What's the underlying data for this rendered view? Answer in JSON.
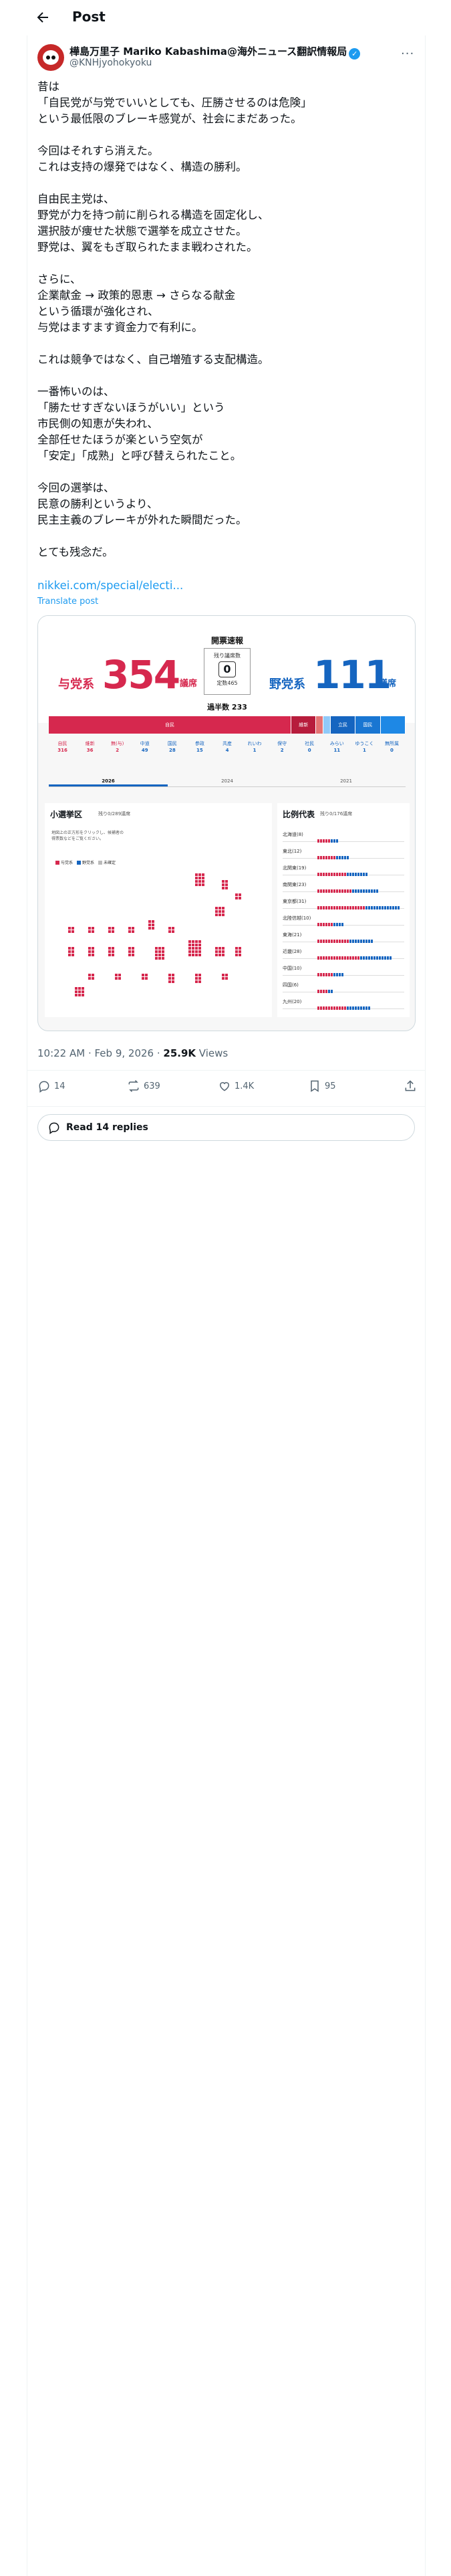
{
  "header": {
    "title": "Post"
  },
  "author": {
    "name": "樺島万里子 Mariko Kabashima@海外ニュース翻訳情報局",
    "handle": "@KNHjyohokyoku"
  },
  "post": {
    "paragraphs": [
      "昔は\n「自民党が与党でいいとしても、圧勝させるのは危険」\nという最低限のブレーキ感覚が、社会にまだあった。",
      "今回はそれすら消えた。\nこれは支持の爆発ではなく、構造の勝利。",
      "自由民主党は、\n野党が力を持つ前に削られる構造を固定化し、\n選択肢が痩せた状態で選挙を成立させた。\n野党は、翼をもぎ取られたまま戦わされた。",
      "さらに、\n企業献金 → 政策的恩恵 → さらなる献金\nという循環が強化され、\n与党はますます資金力で有利に。",
      "これは競争ではなく、自己増殖する支配構造。",
      "一番怖いのは、\n「勝たせすぎないほうがいい」という\n市民側の知恵が失われ、\n全部任せたほうが楽という空気が\n「安定」「成熟」と呼び替えられたこと。",
      "今回の選挙は、\n民意の勝利というより、\n民主主義のブレーキが外れた瞬間だった。",
      "とても残念だ。"
    ],
    "link": "nikkei.com/special/electi...",
    "translate": "Translate post"
  },
  "infographic": {
    "title": "開票速報",
    "ruling": {
      "label": "与党系",
      "seats": "354",
      "unit": "議席"
    },
    "opposition": {
      "label": "野党系",
      "seats": "111",
      "unit": "議席"
    },
    "remaining_label": "残り議席数",
    "remaining": "0",
    "total_label": "定数465",
    "majority": "過半数 233",
    "seat_bar": [
      {
        "label": "自民",
        "share": 0.68,
        "color": "#d6284e"
      },
      {
        "label": "維新",
        "share": 0.07,
        "color": "#b71c3c"
      },
      {
        "label": "",
        "share": 0.02,
        "color": "#e57373"
      },
      {
        "label": "",
        "share": 0.02,
        "color": "#90caf9"
      },
      {
        "label": "立民",
        "share": 0.07,
        "color": "#1565c0"
      },
      {
        "label": "国民",
        "share": 0.07,
        "color": "#1976d2"
      },
      {
        "label": "",
        "share": 0.07,
        "color": "#1e88e5"
      }
    ],
    "parties": [
      {
        "name": "自民",
        "seats": "316",
        "color": "#d6284e"
      },
      {
        "name": "維新",
        "seats": "36",
        "color": "#d6284e"
      },
      {
        "name": "無(与)",
        "seats": "2",
        "color": "#d6284e"
      },
      {
        "name": "中道",
        "seats": "49",
        "color": "#1565c0"
      },
      {
        "name": "国民",
        "seats": "28",
        "color": "#1565c0"
      },
      {
        "name": "参政",
        "seats": "15",
        "color": "#1565c0"
      },
      {
        "name": "共産",
        "seats": "4",
        "color": "#1565c0"
      },
      {
        "name": "れいわ",
        "seats": "1",
        "color": "#1565c0"
      },
      {
        "name": "保守",
        "seats": "2",
        "color": "#1565c0"
      },
      {
        "name": "社民",
        "seats": "0",
        "color": "#1565c0"
      },
      {
        "name": "みらい",
        "seats": "11",
        "color": "#1565c0"
      },
      {
        "name": "ゆうこく",
        "seats": "1",
        "color": "#1565c0"
      },
      {
        "name": "無所属",
        "seats": "0",
        "color": "#1565c0"
      }
    ],
    "tabs": [
      "2026",
      "2024",
      "2021"
    ],
    "smd": {
      "title": "小選挙区",
      "subtitle": "残り0/289議席",
      "note": "地図上の正方形をクリックし、候補者の得票数などをご覧ください。",
      "legend": [
        "与党系",
        "野党系",
        "未確定"
      ]
    },
    "pr": {
      "title": "比例代表",
      "subtitle": "残り0/176議席",
      "blocks": [
        {
          "name": "北海道(8)",
          "dots": 8
        },
        {
          "name": "東北(12)",
          "dots": 12
        },
        {
          "name": "北関東(19)",
          "dots": 19
        },
        {
          "name": "南関東(23)",
          "dots": 23
        },
        {
          "name": "東京都(31)",
          "dots": 31
        },
        {
          "name": "北陸信越(10)",
          "dots": 10
        },
        {
          "name": "東海(21)",
          "dots": 21
        },
        {
          "name": "近畿(28)",
          "dots": 28
        },
        {
          "name": "中国(10)",
          "dots": 10
        },
        {
          "name": "四国(6)",
          "dots": 6
        },
        {
          "name": "九州(20)",
          "dots": 20
        }
      ]
    }
  },
  "meta": {
    "time": "10:22 AM · Feb 9, 2026 · ",
    "views": "25.9K",
    "views_label": " Views"
  },
  "actions": {
    "replies": "14",
    "reposts": "639",
    "likes": "1.4K",
    "bookmarks": "95"
  },
  "read_replies": "Read 14 replies",
  "colors": {
    "link": "#1d9bf0",
    "ruling": "#d6284e",
    "opposition": "#1565c0"
  }
}
